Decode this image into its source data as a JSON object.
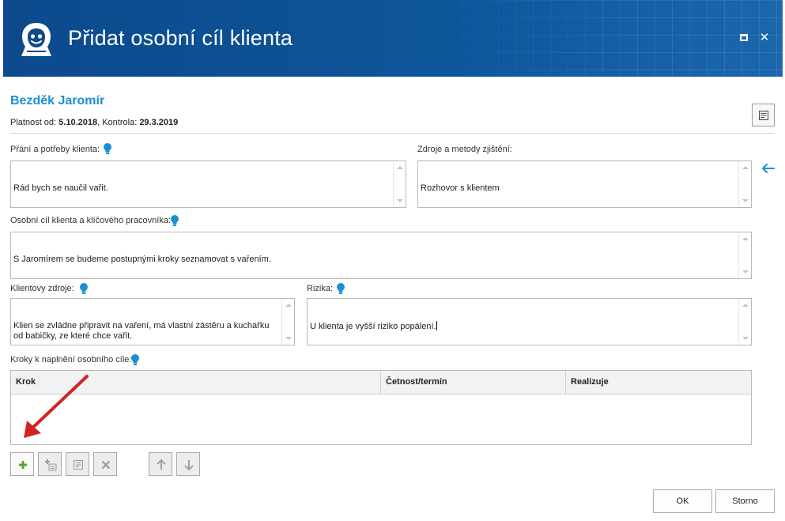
{
  "window": {
    "title": "Přidat osobní cíl klienta",
    "accent_color": "#0d5599",
    "maximize_icon": "maximize-icon",
    "close_icon": "close-icon"
  },
  "client": {
    "name": "Bezděk Jaromír",
    "validity_from_label": "Platnost od:",
    "validity_from": "5.10.2018",
    "separator": ",",
    "check_label": "Kontrola:",
    "check_date": "29.3.2019",
    "name_color": "#1a8fd2"
  },
  "fields": {
    "wishes": {
      "label": "Přání a potřeby klienta:",
      "value": "Rád bych se naučil vařit."
    },
    "sources": {
      "label": "Zdroje a metody zjištění:",
      "value": "Rozhovor s klientem"
    },
    "goal": {
      "label": "Osobní cíl klienta a klíčového pracovníka:",
      "value": "S Jaromírem se budeme postupnými kroky seznamovat s vařením."
    },
    "client_resources": {
      "label": "Klientovy zdroje:",
      "value": "Klien se zvládne připravit na vaření, má vlastní zástěru a kuchařku od babičky, ze které chce vařit."
    },
    "risks": {
      "label": "Rizika:",
      "value": "U klienta je vyšší riziko popálení."
    },
    "steps": {
      "label": "Kroky k naplnění osobního cíle:"
    }
  },
  "steps_table": {
    "columns": [
      "Krok",
      "Četnost/termín",
      "Realizuje"
    ],
    "rows": []
  },
  "toolbar": {
    "buttons": [
      {
        "icon": "add-icon",
        "enabled": true
      },
      {
        "icon": "add-substep-icon",
        "enabled": false
      },
      {
        "icon": "edit-icon",
        "enabled": false
      },
      {
        "icon": "delete-icon",
        "enabled": false
      },
      {
        "icon": "move-up-icon",
        "enabled": false
      },
      {
        "icon": "move-down-icon",
        "enabled": false
      }
    ]
  },
  "dialog": {
    "ok_label": "OK",
    "cancel_label": "Storno"
  },
  "colors": {
    "hint_icon": "#1a8fd2",
    "add_icon": "#5aa82b",
    "annotation_arrow": "#d42222"
  }
}
